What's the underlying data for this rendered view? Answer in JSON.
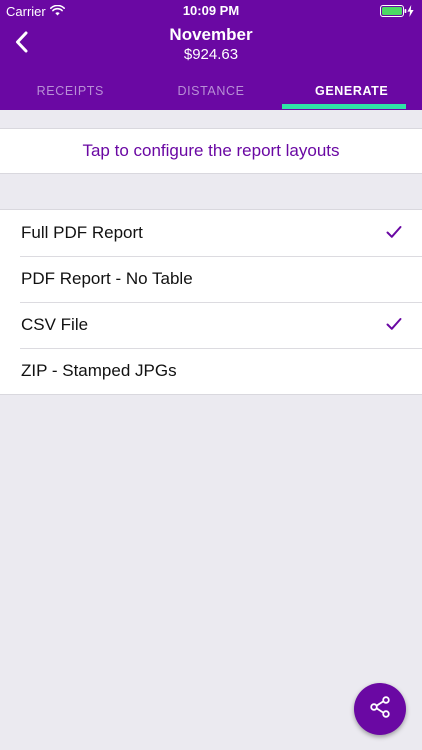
{
  "status_bar": {
    "carrier": "Carrier",
    "time": "10:09 PM",
    "icons": [
      "wifi-icon",
      "battery-icon",
      "charging-icon"
    ]
  },
  "header": {
    "title": "November",
    "subtitle": "$924.63",
    "back_icon": "chevron-left-icon"
  },
  "tabs": [
    {
      "label": "RECEIPTS",
      "active": false
    },
    {
      "label": "DISTANCE",
      "active": false
    },
    {
      "label": "GENERATE",
      "active": true
    }
  ],
  "configure": {
    "label": "Tap to configure the report layouts"
  },
  "report_options": [
    {
      "label": "Full PDF Report",
      "checked": true
    },
    {
      "label": "PDF Report - No Table",
      "checked": false
    },
    {
      "label": "CSV File",
      "checked": true
    },
    {
      "label": "ZIP - Stamped JPGs",
      "checked": false
    }
  ],
  "fab": {
    "icon": "share-icon"
  },
  "colors": {
    "brand": "#6a08a3",
    "tab_indicator": "#2fe3a8",
    "background": "#ebeaf0"
  }
}
